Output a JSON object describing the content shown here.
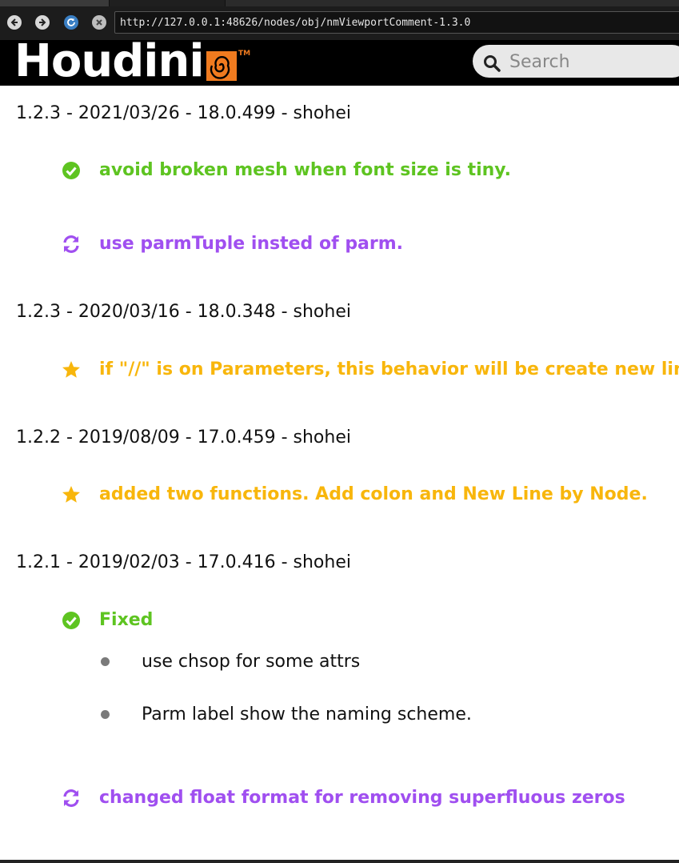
{
  "browser": {
    "url": "http://127.0.0.1:48626/nodes/obj/nmViewportComment-1.3.0"
  },
  "header": {
    "logo_text": "Houdini",
    "logo_tm": "TM",
    "search_placeholder": "Search"
  },
  "colors": {
    "fixed": "#5ec421",
    "changed": "#a04ff0",
    "new": "#f8b60c"
  },
  "releases": [
    {
      "heading": "1.2.3 - 2021/03/26 - 18.0.499 - shohei",
      "entries": [
        {
          "type": "fixed",
          "icon": "check-circle-icon",
          "text": "avoid broken mesh when font size is tiny."
        },
        {
          "type": "changed",
          "icon": "refresh-icon",
          "text": "use parmTuple insted of parm."
        }
      ]
    },
    {
      "heading": "1.2.3 - 2020/03/16 - 18.0.348 - shohei",
      "entries": [
        {
          "type": "new",
          "icon": "star-icon",
          "text": "if \"//\" is on Parameters, this behavior will be create new line."
        }
      ]
    },
    {
      "heading": "1.2.2 - 2019/08/09 - 17.0.459 - shohei",
      "entries": [
        {
          "type": "new",
          "icon": "star-icon",
          "text": "added two functions. Add colon and New Line by Node."
        }
      ]
    },
    {
      "heading": "1.2.1 - 2019/02/03 - 17.0.416 - shohei",
      "entries": [
        {
          "type": "fixed",
          "icon": "check-circle-icon",
          "text": "Fixed",
          "bullets": [
            "use chsop for some attrs",
            "Parm label show the naming scheme."
          ]
        },
        {
          "type": "changed",
          "icon": "refresh-icon",
          "text": "changed float format for removing superfluous zeros"
        }
      ]
    }
  ]
}
